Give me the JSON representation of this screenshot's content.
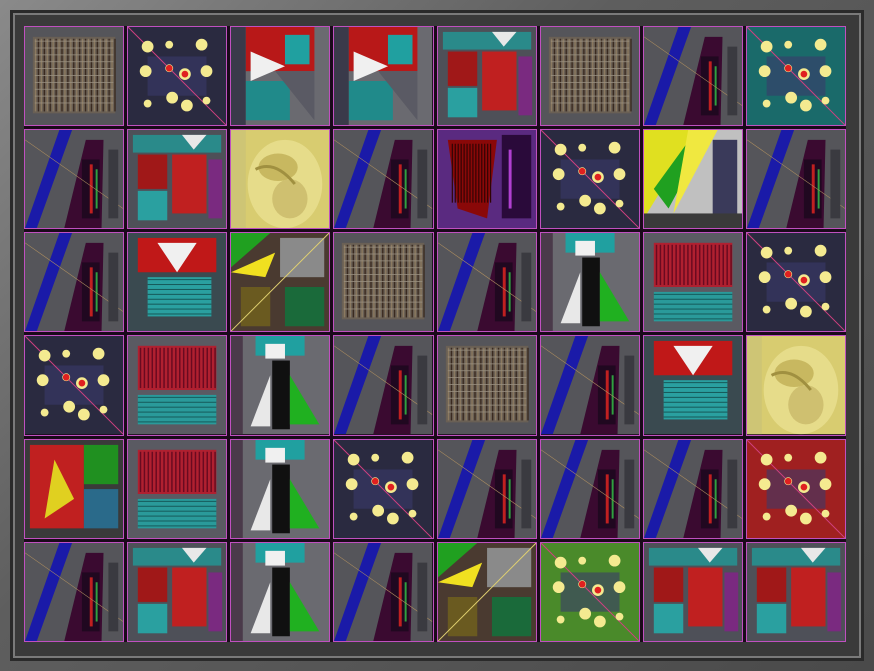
{
  "image": {
    "description_type": "mosaic",
    "grid": {
      "columns": 8,
      "rows": 6
    },
    "tiles": [
      [
        "striped",
        "dots",
        "triangle",
        "triangle",
        "blocks",
        "striped",
        "stripe",
        "dots-teal"
      ],
      [
        "stripe",
        "blocks",
        "figure",
        "stripe",
        "dark-red",
        "dots",
        "yellow-green",
        "stripe"
      ],
      [
        "stripe",
        "v-shape",
        "collage",
        "striped",
        "stripe",
        "green-tri",
        "red-grid",
        "dots"
      ],
      [
        "dots",
        "red-grid",
        "green-tri",
        "stripe",
        "striped",
        "stripe",
        "v-shape",
        "figure"
      ],
      [
        "red-collage",
        "red-grid",
        "green-tri",
        "dots",
        "stripe",
        "stripe",
        "stripe",
        "dots-red"
      ],
      [
        "stripe",
        "blocks",
        "green-tri",
        "stripe",
        "collage",
        "dots-green",
        "blocks",
        "blocks"
      ]
    ],
    "colors": {
      "frame": "#5c5c5c",
      "border": "#c050c0",
      "base": "#55555a"
    }
  }
}
